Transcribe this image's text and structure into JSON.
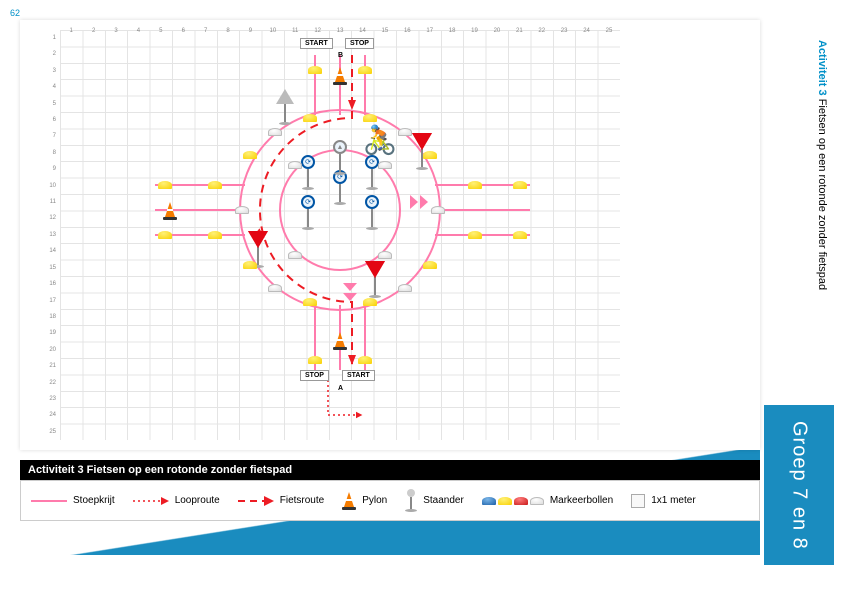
{
  "page_number": "62",
  "side_header": {
    "activity": "Activiteit 3",
    "title": "Fietsen op een rotonde zonder fietspad"
  },
  "side_group": "Groep 7 en 8",
  "caption_title": "Activiteit 3 Fietsen op een rotonde zonder fietspad",
  "grid": {
    "cols": 25,
    "rows": 25
  },
  "legend": {
    "stoepkrijt": "Stoepkrijt",
    "looproute": "Looproute",
    "fietsroute": "Fietsroute",
    "pylon": "Pylon",
    "staander": "Staander",
    "markeerbollen": "Markeerbollen",
    "grid_unit": "1x1 meter"
  },
  "labels": {
    "start_top": "START",
    "stop_top": "STOP",
    "marker_b": "B",
    "stop_bottom": "STOP",
    "start_bottom": "START",
    "marker_a": "A"
  }
}
